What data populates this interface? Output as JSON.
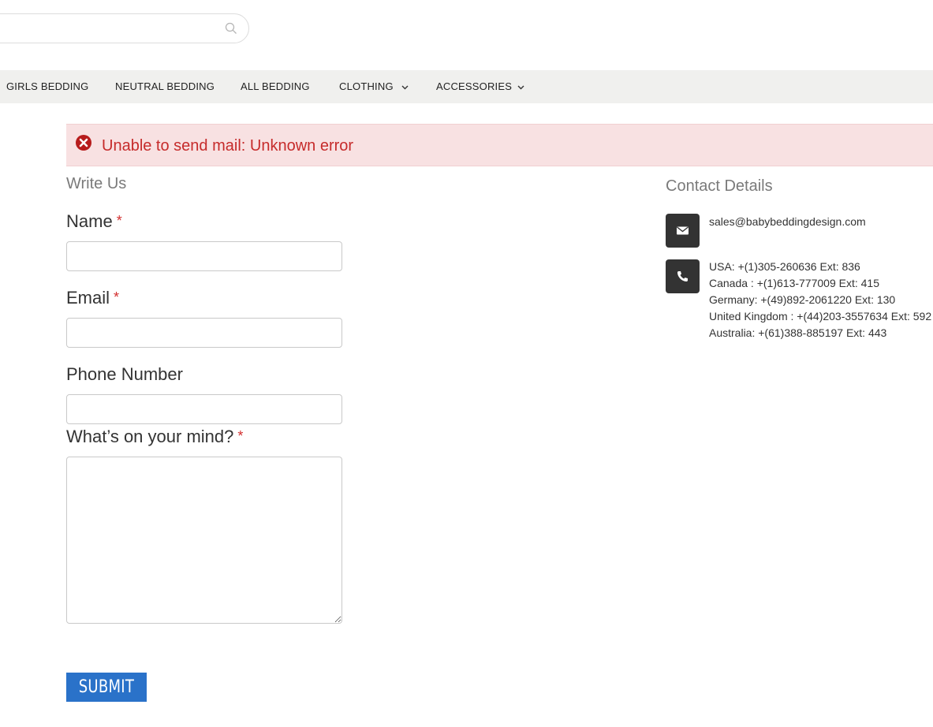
{
  "search": {
    "placeholder": ""
  },
  "nav": {
    "items": [
      {
        "label": "GIRLS BEDDING",
        "has_dropdown": false
      },
      {
        "label": "NEUTRAL BEDDING",
        "has_dropdown": false
      },
      {
        "label": "ALL BEDDING",
        "has_dropdown": false
      },
      {
        "label": "CLOTHING",
        "has_dropdown": true
      },
      {
        "label": "ACCESSORIES",
        "has_dropdown": true
      }
    ]
  },
  "alert": {
    "message": "Unable to send mail: Unknown error",
    "icon": "error-circle-icon",
    "color": "#c62b2b",
    "background": "#f8e1e2"
  },
  "form": {
    "title": "Write Us",
    "required_marker": "*",
    "name_label": "Name",
    "email_label": "Email",
    "phone_label": "Phone Number",
    "message_label": "What’s on your mind?",
    "name_value": "",
    "email_value": "",
    "phone_value": "",
    "message_value": "",
    "submit_label": "SUBMIT",
    "submit_color": "#2a72c9"
  },
  "contact": {
    "title": "Contact Details",
    "email": "sales@babybeddingdesign.com",
    "email_icon": "envelope-icon",
    "phone_icon": "phone-icon",
    "phones": [
      "USA: +(1)305-260636 Ext: 836",
      "Canada : +(1)613-777009 Ext: 415",
      "Germany: +(49)892-2061220 Ext: 130",
      "United Kingdom : +(44)203-3557634 Ext: 592",
      "Australia: +(61)388-885197 Ext: 443"
    ]
  }
}
